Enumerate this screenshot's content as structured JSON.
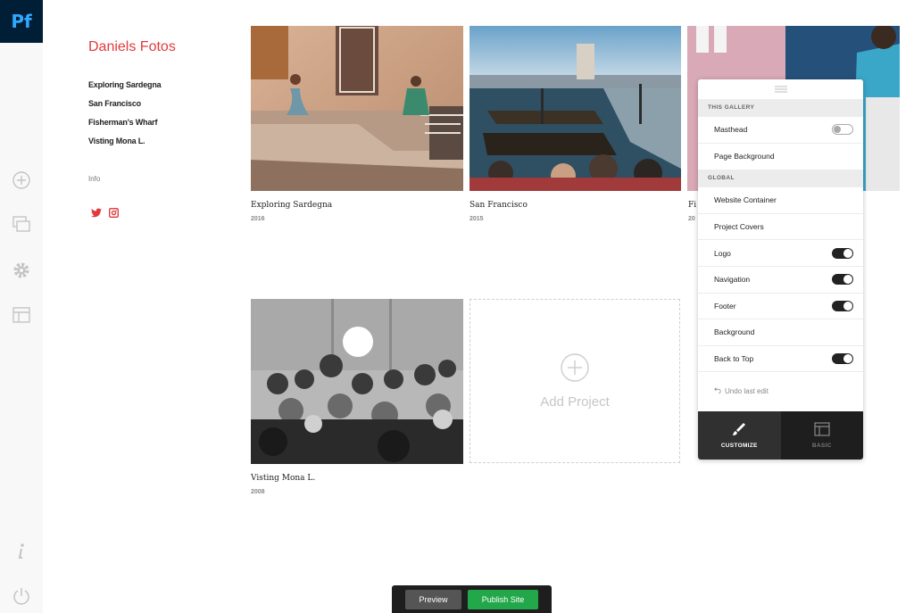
{
  "app": {
    "logo_text": "Pf"
  },
  "rail": {
    "icons": [
      "plus-circle-icon",
      "pages-icon",
      "gear-icon",
      "layout-icon",
      "info-icon",
      "power-icon"
    ]
  },
  "site": {
    "title": "Daniels Fotos",
    "nav": [
      "Exploring Sardegna",
      "San Francisco",
      "Fisherman's Wharf",
      "Visting Mona L."
    ],
    "info": "Info",
    "social": [
      "twitter-icon",
      "instagram-icon"
    ]
  },
  "projects": [
    {
      "title": "Exploring Sardegna",
      "year": "2016"
    },
    {
      "title": "San Francisco",
      "year": "2015"
    },
    {
      "title": "Fi",
      "year": "20"
    },
    {
      "title": "Visting Mona L.",
      "year": "2008"
    }
  ],
  "add_project": {
    "label": "Add Project"
  },
  "panel": {
    "section_gallery": "THIS GALLERY",
    "section_global": "GLOBAL",
    "gallery_rows": [
      {
        "label": "Masthead",
        "toggle": "off"
      },
      {
        "label": "Page Background"
      }
    ],
    "global_rows": [
      {
        "label": "Website Container"
      },
      {
        "label": "Project Covers"
      },
      {
        "label": "Logo",
        "toggle": "on"
      },
      {
        "label": "Navigation",
        "toggle": "on"
      },
      {
        "label": "Footer",
        "toggle": "on"
      },
      {
        "label": "Background"
      },
      {
        "label": "Back to Top",
        "toggle": "on"
      }
    ],
    "undo": "Undo last edit",
    "tabs": [
      {
        "label": "CUSTOMIZE",
        "icon": "brush-icon",
        "active": true
      },
      {
        "label": "BASIC",
        "icon": "layout-icon",
        "active": false
      }
    ]
  },
  "bottom": {
    "preview": "Preview",
    "publish": "Publish Site"
  },
  "colors": {
    "brand_red": "#e03a3e",
    "publish_green": "#22a84a",
    "logo_bg": "#001e36",
    "logo_text": "#31a8ff"
  }
}
